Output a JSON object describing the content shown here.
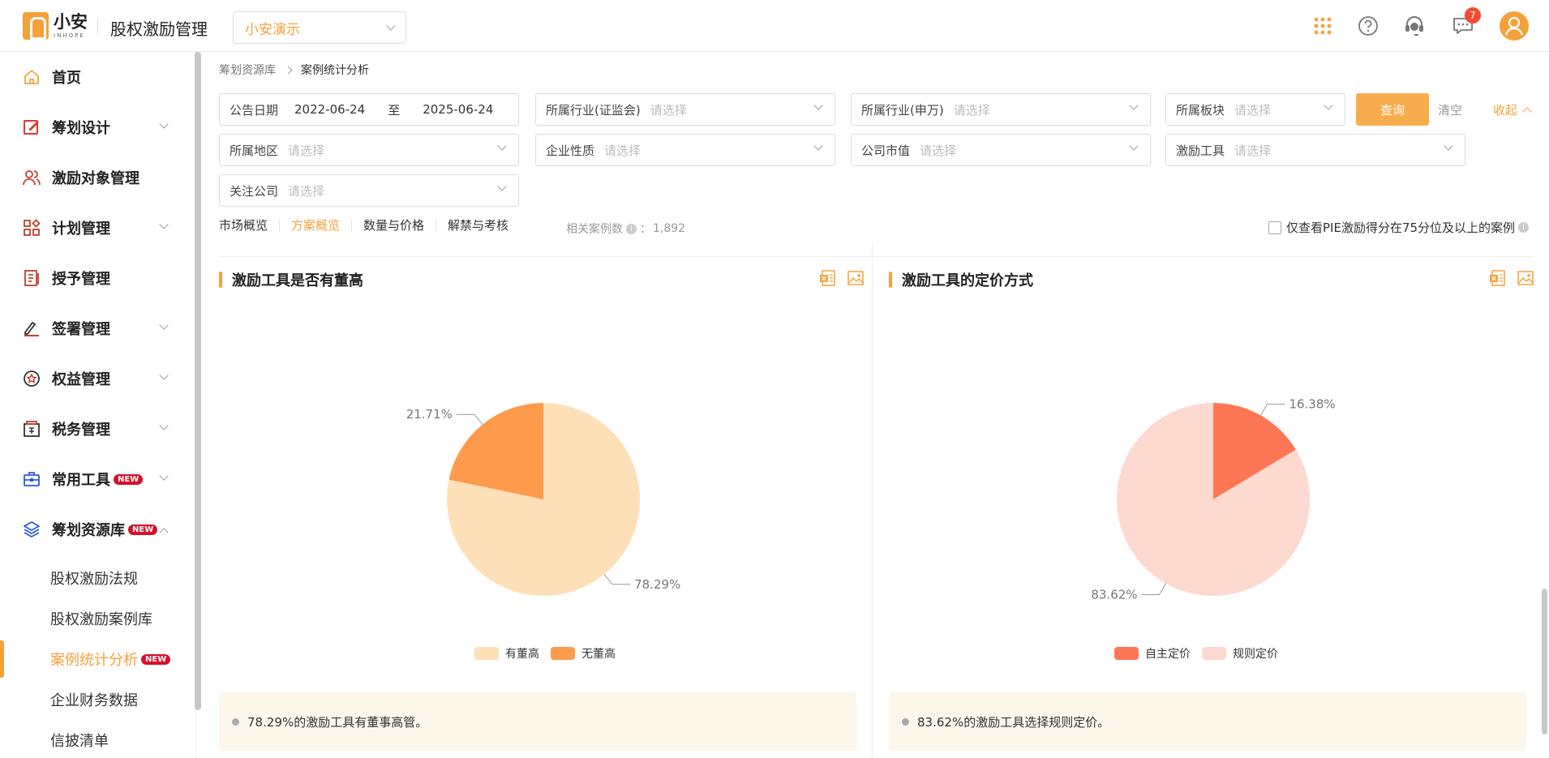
{
  "header": {
    "logo_cn": "小安",
    "logo_en": "INHOPE",
    "app_title": "股权激励管理",
    "org_select": "小安演示",
    "message_count": "7"
  },
  "sidebar": {
    "items": [
      {
        "label": "首页",
        "icon": "home-icon"
      },
      {
        "label": "筹划设计",
        "icon": "edit-icon"
      },
      {
        "label": "激励对象管理",
        "icon": "users-icon"
      },
      {
        "label": "计划管理",
        "icon": "apps-icon"
      },
      {
        "label": "授予管理",
        "icon": "book-icon"
      },
      {
        "label": "签署管理",
        "icon": "sign-icon"
      },
      {
        "label": "权益管理",
        "icon": "badge-icon"
      },
      {
        "label": "税务管理",
        "icon": "tax-icon"
      },
      {
        "label": "常用工具",
        "icon": "toolbox-icon",
        "new": "NEW"
      },
      {
        "label": "筹划资源库",
        "icon": "layers-icon",
        "new": "NEW"
      }
    ],
    "sub_items": [
      {
        "label": "股权激励法规"
      },
      {
        "label": "股权激励案例库"
      },
      {
        "label": "案例统计分析",
        "new": "NEW"
      },
      {
        "label": "企业财务数据"
      },
      {
        "label": "信披清单"
      }
    ]
  },
  "breadcrumb": {
    "parent": "筹划资源库",
    "current": "案例统计分析"
  },
  "filters": {
    "date_label": "公告日期",
    "date_from": "2022-06-24",
    "date_to_sep": "至",
    "date_to": "2025-06-24",
    "industry_csrc": "所属行业(证监会)",
    "industry_sw": "所属行业(申万)",
    "board": "所属板块",
    "region": "所属地区",
    "nature": "企业性质",
    "market_cap": "公司市值",
    "tool": "激励工具",
    "follow": "关注公司",
    "placeholder": "请选择",
    "query_btn": "查询",
    "clear": "清空",
    "collapse": "收起"
  },
  "tabs": [
    {
      "label": "市场概览"
    },
    {
      "label": "方案概览"
    },
    {
      "label": "数量与价格"
    },
    {
      "label": "解禁与考核"
    }
  ],
  "case_count": {
    "label": "相关案例数",
    "sep": "：",
    "value": "1,892"
  },
  "pie_filter_label": "仅查看PIE激励得分在75分位及以上的案例",
  "chart_data": [
    {
      "type": "pie",
      "title": "激励工具是否有董高",
      "slices": [
        {
          "name": "有董高",
          "value": 78.29,
          "label": "78.29%",
          "color": "#fee0b8"
        },
        {
          "name": "无董高",
          "value": 21.71,
          "label": "21.71%",
          "color": "#fd9a4b"
        }
      ],
      "legend": "bottom",
      "note": "78.29%的激励工具有董事高管。"
    },
    {
      "type": "pie",
      "title": "激励工具的定价方式",
      "slices": [
        {
          "name": "自主定价",
          "value": 16.38,
          "label": "16.38%",
          "color": "#fe7755"
        },
        {
          "name": "规则定价",
          "value": 83.62,
          "label": "83.62%",
          "color": "#fed9d0"
        }
      ],
      "legend": "bottom",
      "note": "83.62%的激励工具选择规则定价。"
    }
  ]
}
